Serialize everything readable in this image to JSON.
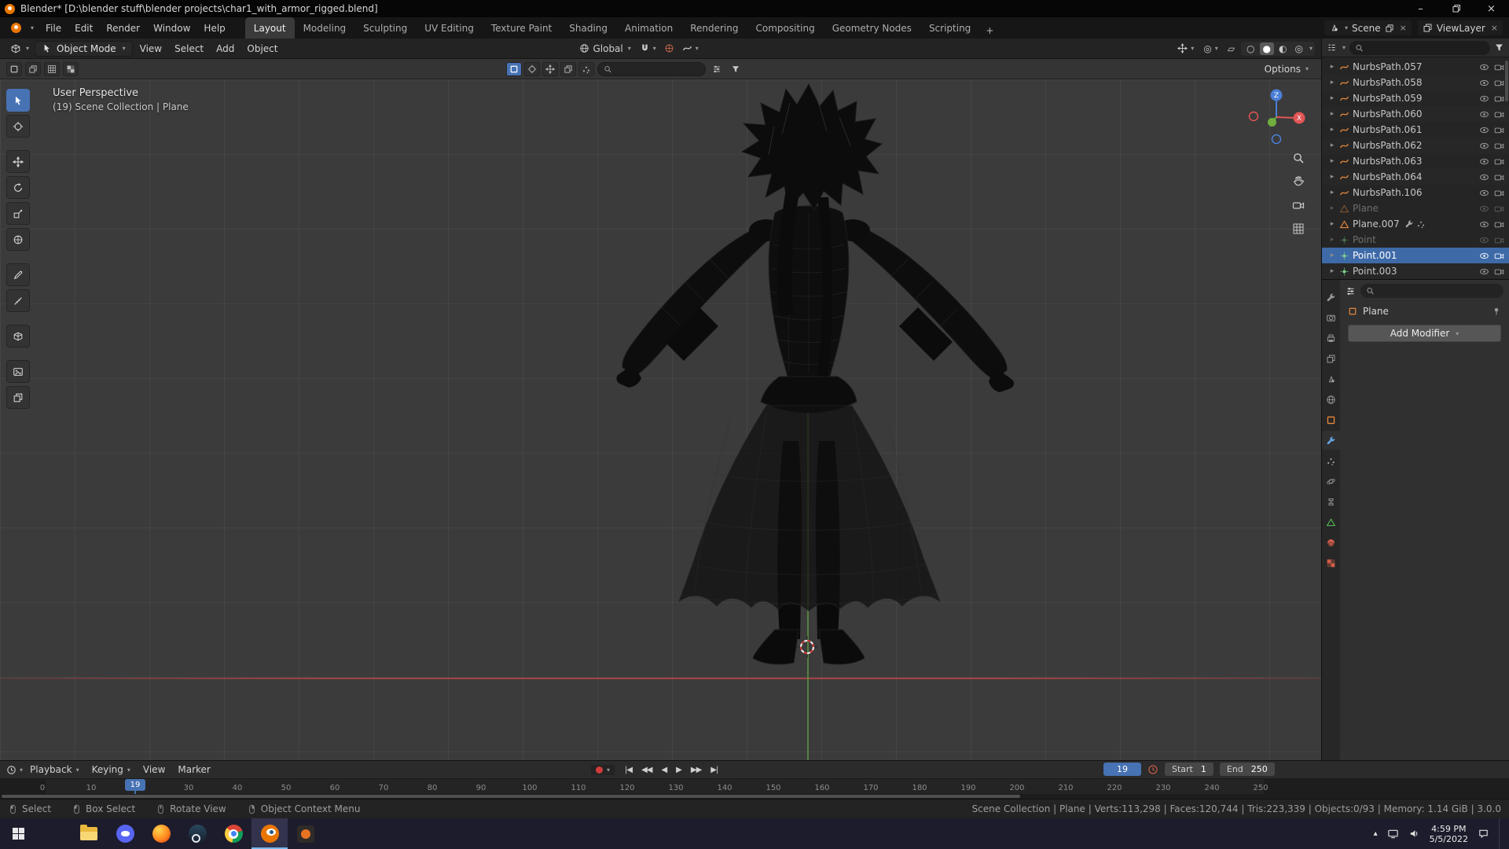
{
  "titlebar": {
    "title": "Blender*  [D:\\blender stuff\\blender projects\\char1_with_armor_rigged.blend]",
    "controls": {
      "minimize": "–",
      "close": "×"
    }
  },
  "topbar": {
    "menus": [
      "File",
      "Edit",
      "Render",
      "Window",
      "Help"
    ],
    "workspaces": [
      "Layout",
      "Modeling",
      "Sculpting",
      "UV Editing",
      "Texture Paint",
      "Shading",
      "Animation",
      "Rendering",
      "Compositing",
      "Geometry Nodes",
      "Scripting"
    ],
    "active_workspace": "Layout",
    "add_workspace": "+",
    "scene": {
      "label": "Scene"
    },
    "viewlayer": {
      "label": "ViewLayer"
    }
  },
  "viewport": {
    "header": {
      "mode": "Object Mode",
      "menus": [
        "View",
        "Select",
        "Add",
        "Object"
      ],
      "orientation": "Global"
    },
    "tools_row": {
      "options_label": "Options"
    },
    "overlay": {
      "line1": "User Perspective",
      "line2": "(19) Scene Collection | Plane"
    },
    "gizmo": {
      "x_label": "X",
      "z_label": "Z"
    }
  },
  "outliner": {
    "items": [
      {
        "label": "NurbsPath.057",
        "icon": "curve"
      },
      {
        "label": "NurbsPath.058",
        "icon": "curve"
      },
      {
        "label": "NurbsPath.059",
        "icon": "curve"
      },
      {
        "label": "NurbsPath.060",
        "icon": "curve"
      },
      {
        "label": "NurbsPath.061",
        "icon": "curve"
      },
      {
        "label": "NurbsPath.062",
        "icon": "curve"
      },
      {
        "label": "NurbsPath.063",
        "icon": "curve"
      },
      {
        "label": "NurbsPath.064",
        "icon": "curve"
      },
      {
        "label": "NurbsPath.106",
        "icon": "curve"
      },
      {
        "label": "Plane",
        "icon": "mesh",
        "state": "dimmed"
      },
      {
        "label": "Plane.007",
        "icon": "mesh"
      },
      {
        "label": "Point",
        "icon": "light",
        "state": "dimmed"
      },
      {
        "label": "Point.001",
        "icon": "light",
        "state": "selected"
      },
      {
        "label": "Point.003",
        "icon": "light"
      }
    ]
  },
  "properties": {
    "breadcrumb": "Plane",
    "add_modifier": "Add Modifier"
  },
  "timeline": {
    "menus": [
      "Playback",
      "Keying",
      "View",
      "Marker"
    ],
    "current_frame": "19",
    "playhead_label": "19",
    "start_label": "Start",
    "start_value": "1",
    "end_label": "End",
    "end_value": "250",
    "ticks": [
      "0",
      "10",
      "30",
      "40",
      "50",
      "60",
      "70",
      "80",
      "90",
      "100",
      "110",
      "120",
      "130",
      "140",
      "150",
      "160",
      "170",
      "180",
      "190",
      "200",
      "210",
      "220",
      "230",
      "240",
      "250"
    ]
  },
  "statusbar": {
    "hints": [
      {
        "label": "Select"
      },
      {
        "label": "Box Select"
      },
      {
        "label": "Rotate View"
      },
      {
        "label": "Object Context Menu"
      }
    ],
    "stats": "Scene Collection | Plane | Verts:113,298 | Faces:120,744 | Tris:223,339 | Objects:0/93 | Memory: 1.14 GiB | 3.0.0"
  },
  "taskbar": {
    "time": "4:59 PM",
    "date": "5/5/2022"
  },
  "colors": {
    "accent": "#4772b3",
    "object_orange": "#e8883a",
    "axis_x": "#e05555",
    "axis_y": "#6fae3f",
    "axis_z": "#4a7fd6"
  }
}
